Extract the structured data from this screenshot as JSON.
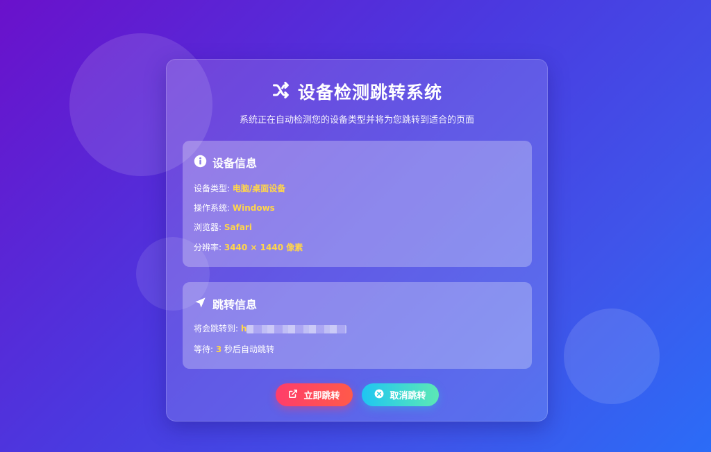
{
  "header": {
    "title": "设备检测跳转系统",
    "subtitle": "系统正在自动检测您的设备类型并将为您跳转到适合的页面",
    "icon": "shuffle-icon"
  },
  "device_panel": {
    "title": "设备信息",
    "icon": "info-circle-icon",
    "rows": [
      {
        "label": "设备类型: ",
        "value": "电脑/桌面设备"
      },
      {
        "label": "操作系统: ",
        "value": "Windows"
      },
      {
        "label": "浏览器: ",
        "value": "Safari"
      },
      {
        "label": "分辨率: ",
        "value": "3440 × 1440 像素"
      }
    ]
  },
  "redirect_panel": {
    "title": "跳转信息",
    "icon": "location-arrow-icon",
    "target_label": "将会跳转到: ",
    "target_value_prefix": "h",
    "wait_label": "等待: ",
    "wait_seconds": "3",
    "wait_suffix": " 秒后自动跳转"
  },
  "buttons": {
    "go_label": "立即跳转",
    "cancel_label": "取消跳转"
  },
  "colors": {
    "accent_value": "#ffd54a",
    "go_button": "#ff3d6a",
    "cancel_button": "#1fc6f2"
  }
}
